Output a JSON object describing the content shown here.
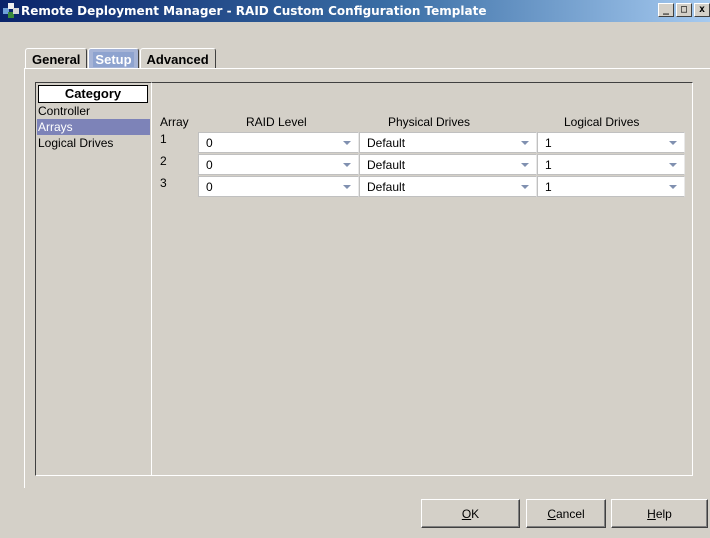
{
  "window": {
    "title": "Remote Deployment Manager - RAID Custom Configuration Template",
    "minimize": "_",
    "maximize": "□",
    "close": "x"
  },
  "tabs": [
    {
      "label": "General",
      "active": false
    },
    {
      "label": "Setup",
      "active": true
    },
    {
      "label": "Advanced",
      "active": false
    }
  ],
  "category": {
    "header": "Category",
    "items": [
      {
        "label": "Controller",
        "selected": false
      },
      {
        "label": "Arrays",
        "selected": true
      },
      {
        "label": "Logical Drives",
        "selected": false
      }
    ]
  },
  "grid": {
    "columns": {
      "array": "Array",
      "raid_level": "RAID Level",
      "physical_drives": "Physical Drives",
      "logical_drives": "Logical Drives"
    },
    "rows": [
      {
        "array": "1",
        "raid_level": "0",
        "physical_drives": "Default",
        "logical_drives": "1"
      },
      {
        "array": "2",
        "raid_level": "0",
        "physical_drives": "Default",
        "logical_drives": "1"
      },
      {
        "array": "3",
        "raid_level": "0",
        "physical_drives": "Default",
        "logical_drives": "1"
      }
    ]
  },
  "buttons": {
    "ok": {
      "mnemonic": "O",
      "rest": "K"
    },
    "cancel": {
      "mnemonic": "C",
      "rest": "ancel"
    },
    "help": {
      "mnemonic": "H",
      "rest": "elp"
    }
  },
  "colors": {
    "title_bar": "#0a246a",
    "selected_item": "#7d83b8",
    "active_tab": "#8ea3cf"
  },
  "icons": {
    "app": "remote-deployment-icon",
    "dropdown": "chevron-down-icon"
  }
}
